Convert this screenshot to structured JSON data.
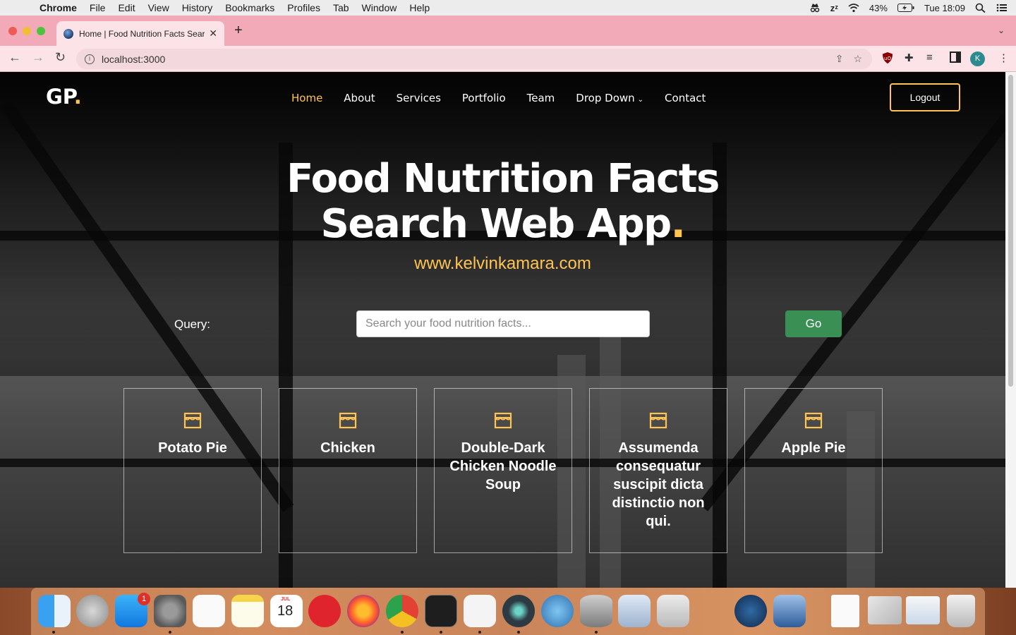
{
  "menubar": {
    "app_name": "Chrome",
    "items": [
      "File",
      "Edit",
      "View",
      "History",
      "Bookmarks",
      "Profiles",
      "Tab",
      "Window",
      "Help"
    ],
    "battery": "43%",
    "clock": "Tue 18:09"
  },
  "browser": {
    "tab_title": "Home | Food Nutrition Facts Search Web App",
    "url": "localhost:3000",
    "profile_initial": "K"
  },
  "site": {
    "logo_text": "GP",
    "logo_dot": ".",
    "nav": {
      "home": "Home",
      "about": "About",
      "services": "Services",
      "portfolio": "Portfolio",
      "team": "Team",
      "dropdown": "Drop Down",
      "contact": "Contact"
    },
    "logout_label": "Logout",
    "hero_line1": "Food Nutrition Facts",
    "hero_line2": "Search Web App",
    "hero_dot": ".",
    "website": "www.kelvinkamara.com",
    "query_label": "Query:",
    "search_placeholder": "Search your food nutrition facts...",
    "go_label": "Go",
    "cards": [
      {
        "title": "Potato Pie"
      },
      {
        "title": "Chicken"
      },
      {
        "title": "Double-Dark Chicken Noodle Soup"
      },
      {
        "title": "Assumenda consequatur suscipit dicta distinctio non qui."
      },
      {
        "title": "Apple Pie"
      }
    ],
    "accent_color": "#ffc451",
    "go_color": "#3a8f55"
  },
  "dock": {
    "appstore_badge": "1",
    "calendar_month": "JUL",
    "calendar_day": "18"
  }
}
